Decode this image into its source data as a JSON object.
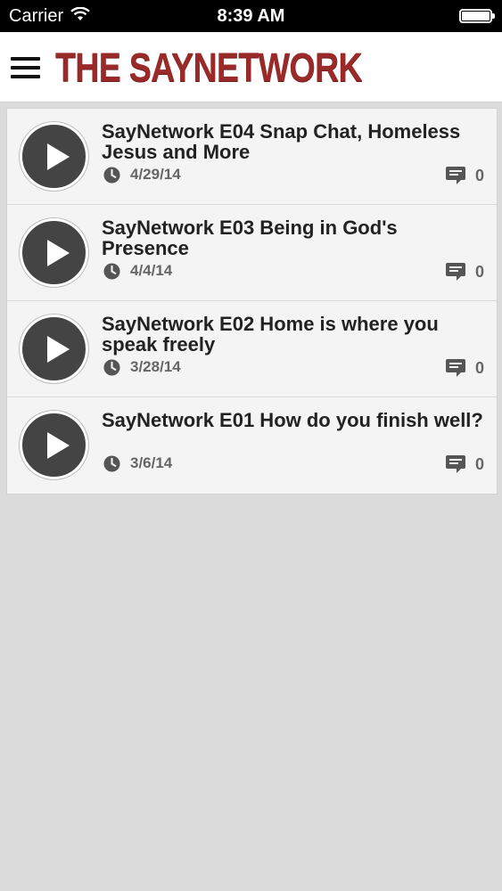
{
  "status_bar": {
    "carrier": "Carrier",
    "time": "8:39 AM"
  },
  "header": {
    "logo_text": "THE SAYNETWORK",
    "logo_color": "#9a2a2a"
  },
  "episodes": [
    {
      "title": "SayNetwork E04 Snap Chat, Homeless Jesus and More",
      "date": "4/29/14",
      "comments": "0"
    },
    {
      "title": "SayNetwork E03 Being in God's Presence",
      "date": "4/4/14",
      "comments": "0"
    },
    {
      "title": "SayNetwork E02 Home is where you speak freely",
      "date": "3/28/14",
      "comments": "0"
    },
    {
      "title": "SayNetwork E01 How do you finish well?",
      "date": "3/6/14",
      "comments": "0"
    }
  ],
  "icons": {
    "menu": "hamburger-menu-icon",
    "play": "play-icon",
    "date": "clock-icon",
    "comments": "comment-bubble-icon"
  }
}
